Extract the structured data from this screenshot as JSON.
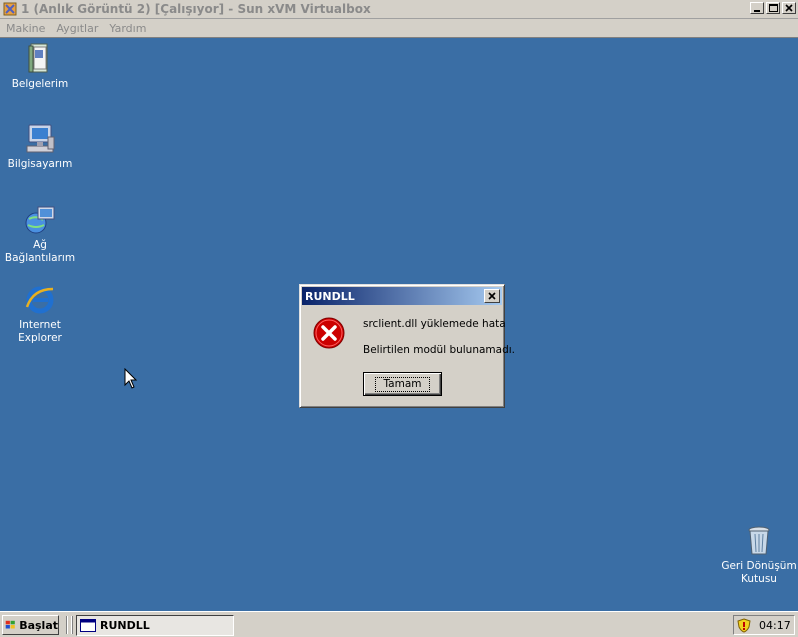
{
  "window": {
    "title": "1 (Anlık Görüntü 2) [Çalışıyor] - Sun xVM Virtualbox",
    "buttons": {
      "minimize": "_",
      "maximize": "□",
      "close": "X"
    }
  },
  "menu": {
    "items": [
      "Makine",
      "Aygıtlar",
      "Yardım"
    ]
  },
  "desktop": {
    "icons": [
      {
        "name": "documents",
        "label": "Belgelerim",
        "icon": "folder-documents-icon"
      },
      {
        "name": "computer",
        "label": "Bilgisayarım",
        "icon": "computer-icon"
      },
      {
        "name": "network",
        "label": "Ağ Bağlantılarım",
        "icon": "network-icon"
      },
      {
        "name": "ie",
        "label_line1": "Internet",
        "label_line2": "Explorer",
        "icon": "internet-explorer-icon"
      },
      {
        "name": "recycle",
        "label_line1": "Geri Dönüşüm",
        "label_line2": "Kutusu",
        "icon": "recycle-bin-icon"
      }
    ]
  },
  "dialog": {
    "title": "RUNDLL",
    "message_line1": "srclient.dll yüklemede hata",
    "message_line2": "Belirtilen modül bulunamadı.",
    "ok_label": "Tamam",
    "icon": "error-icon"
  },
  "taskbar": {
    "start_label": "Başlat",
    "task_label": "RUNDLL",
    "clock": "04:17"
  },
  "colors": {
    "desktop": "#3a6ea5",
    "title_gradient_start": "#0a246a",
    "title_gradient_end": "#a6caf0",
    "error_red": "#cc0000"
  }
}
